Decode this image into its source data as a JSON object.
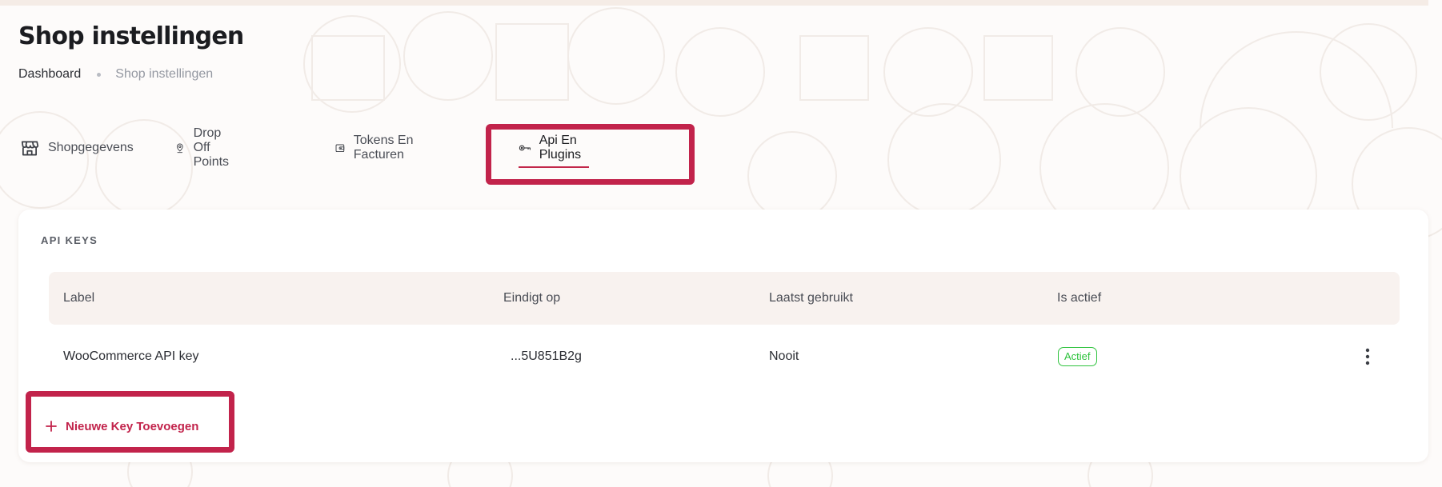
{
  "page": {
    "title": "Shop instellingen"
  },
  "breadcrumb": {
    "home": "Dashboard",
    "current": "Shop instellingen"
  },
  "tabs": [
    {
      "label": "Shopgegevens",
      "icon": "store-icon"
    },
    {
      "label": "Drop Off Points",
      "icon": "location-pin-icon"
    },
    {
      "label": "Tokens En Facturen",
      "icon": "wallet-icon"
    },
    {
      "label": "Api En Plugins",
      "icon": "key-icon",
      "active": true
    }
  ],
  "api_keys": {
    "section_title": "API KEYS",
    "columns": [
      "Label",
      "Eindigt op",
      "Laatst gebruikt",
      "Is actief"
    ],
    "rows": [
      {
        "label": "WooCommerce API key",
        "ends_with": "...5U851B2g",
        "last_used": "Nooit",
        "status": "Actief"
      }
    ],
    "add_button": "Nieuwe Key Toevoegen"
  },
  "colors": {
    "accent": "#c2234b",
    "status_active": "#2ec33d",
    "table_header_bg": "#f8f2ef"
  }
}
